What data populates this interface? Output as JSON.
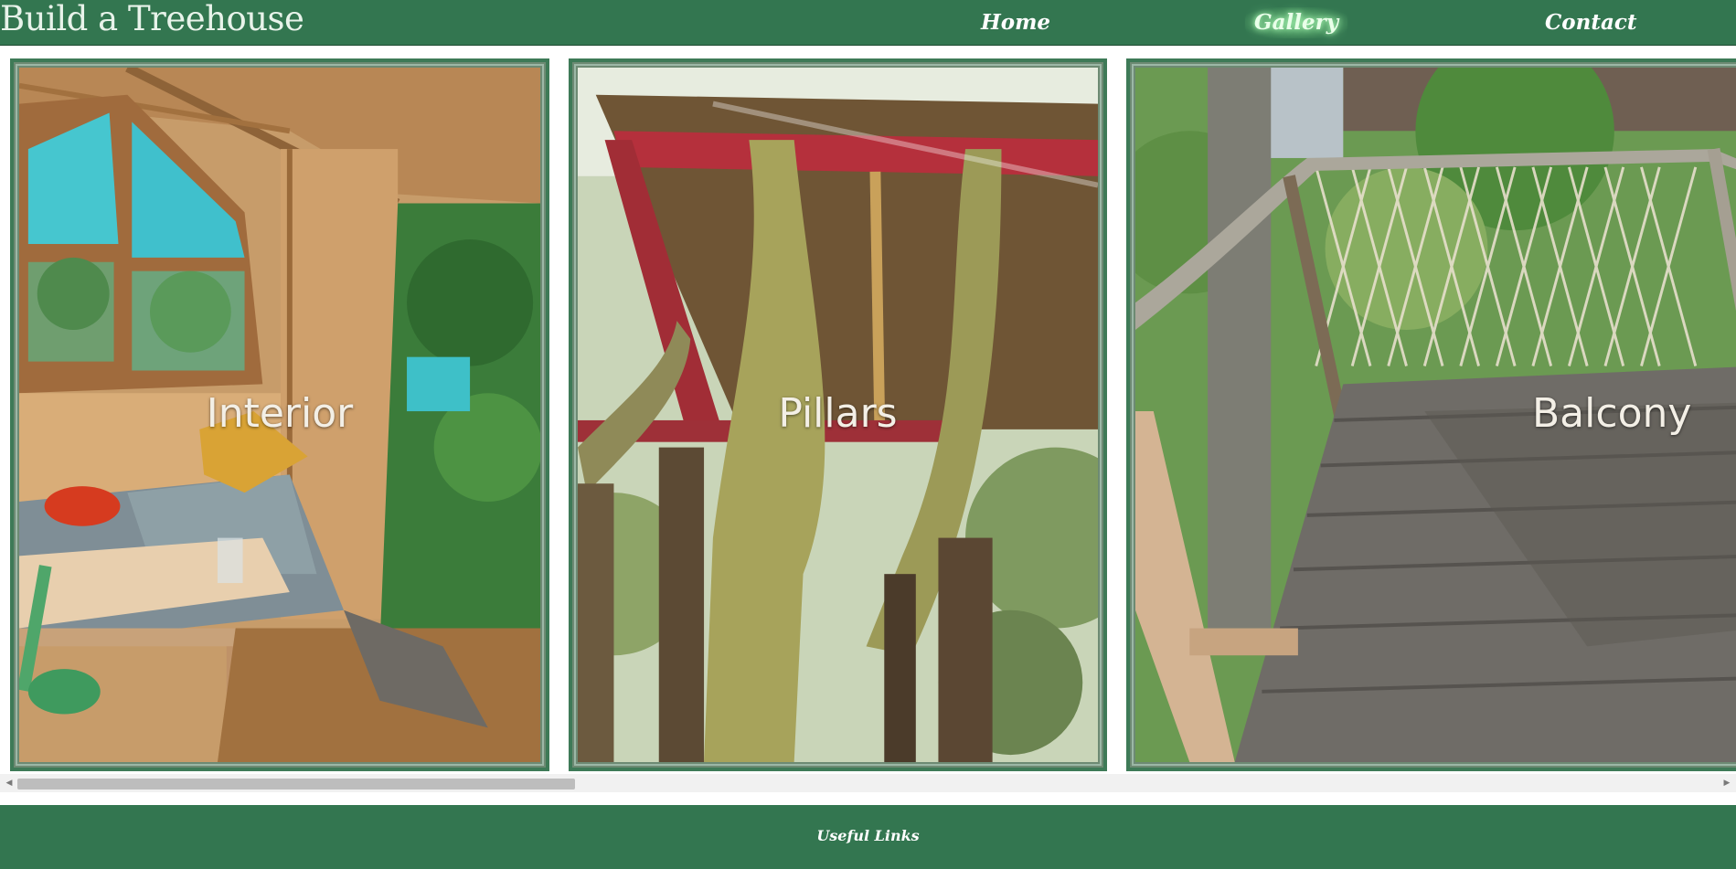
{
  "header": {
    "site_title": "Build a Treehouse",
    "nav": {
      "home": "Home",
      "gallery": "Gallery",
      "contact": "Contact"
    }
  },
  "gallery": {
    "cards": [
      {
        "caption": "Interior",
        "image": "treehouse-interior-photo"
      },
      {
        "caption": "Pillars",
        "image": "treehouse-pillars-photo"
      },
      {
        "caption": "Balcony",
        "image": "treehouse-balcony-photo"
      }
    ]
  },
  "scrollbar": {
    "left_arrow": "◀",
    "right_arrow": "▶"
  },
  "footer": {
    "link": "Useful Links"
  },
  "colors": {
    "header_bg": "#337650",
    "nav_glow": "#a9f5b4",
    "card_border": "#3e7a57",
    "footer_bg": "#337650"
  }
}
